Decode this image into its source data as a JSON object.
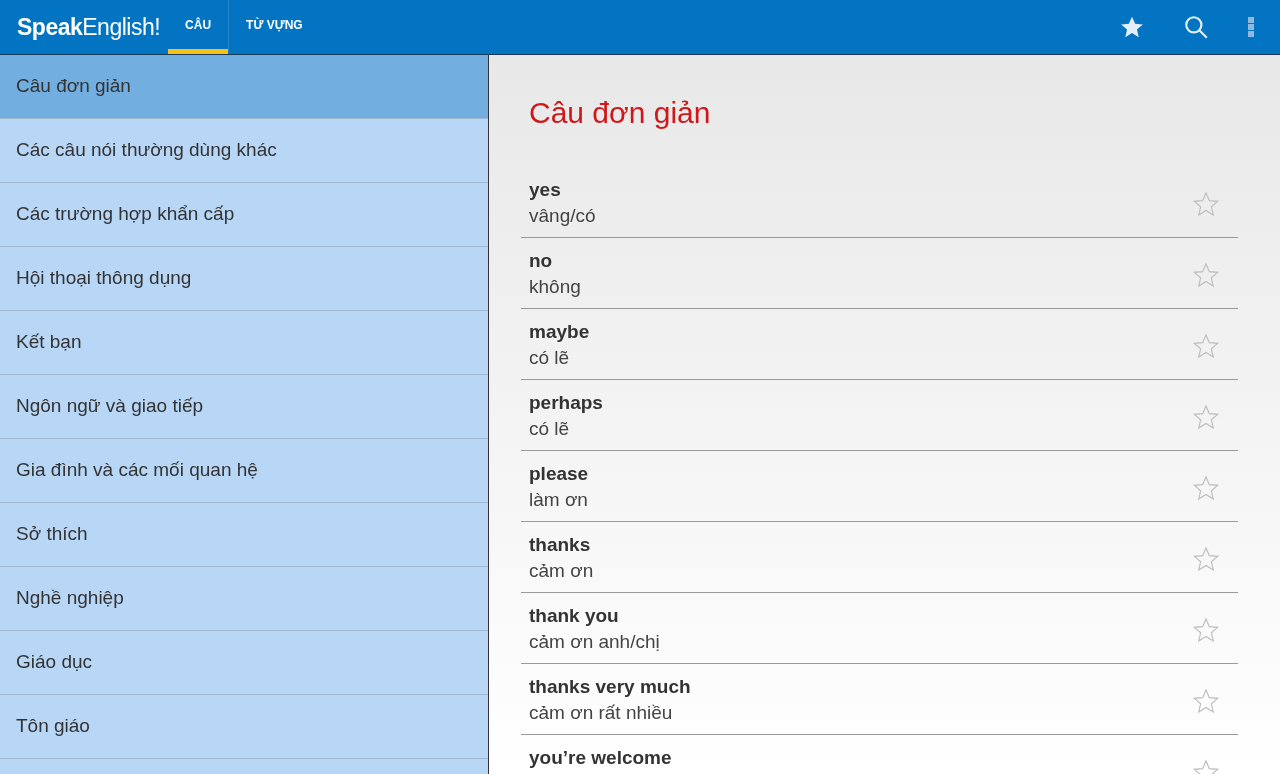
{
  "app_bar": {
    "logo": "**Speak**English!",
    "tabs": [
      {
        "label": "CÂU",
        "selected": true
      },
      {
        "label": "TỪ VỰNG",
        "selected": false
      }
    ]
  },
  "sidebar": {
    "items": [
      {
        "label": "Câu đơn giản",
        "selected": true
      },
      {
        "label": "Các câu nói thường dùng khác",
        "selected": false
      },
      {
        "label": "Các trường hợp khẩn cấp",
        "selected": false
      },
      {
        "label": "Hội thoại thông dụng",
        "selected": false
      },
      {
        "label": "Kết bạn",
        "selected": false
      },
      {
        "label": "Ngôn ngữ và giao tiếp",
        "selected": false
      },
      {
        "label": "Gia đình và các mối quan hệ",
        "selected": false
      },
      {
        "label": "Sở thích",
        "selected": false
      },
      {
        "label": "Nghề nghiệp",
        "selected": false
      },
      {
        "label": "Giáo dục",
        "selected": false
      },
      {
        "label": "Tôn giáo",
        "selected": false
      }
    ]
  },
  "content": {
    "title": "Câu đơn giản",
    "phrases": [
      {
        "en": "yes",
        "vi": "vâng/có",
        "favorite": false
      },
      {
        "en": "no",
        "vi": "không",
        "favorite": false
      },
      {
        "en": "maybe",
        "vi": "có lẽ",
        "favorite": false
      },
      {
        "en": "perhaps",
        "vi": "có lẽ",
        "favorite": false
      },
      {
        "en": "please",
        "vi": "làm ơn",
        "favorite": false
      },
      {
        "en": "thanks",
        "vi": "cảm ơn",
        "favorite": false
      },
      {
        "en": "thank you",
        "vi": "cảm ơn anh/chị",
        "favorite": false
      },
      {
        "en": "thanks very much",
        "vi": "cảm ơn rất nhiều",
        "favorite": false
      },
      {
        "en": "you’re welcome",
        "favorite": false
      }
    ]
  }
}
